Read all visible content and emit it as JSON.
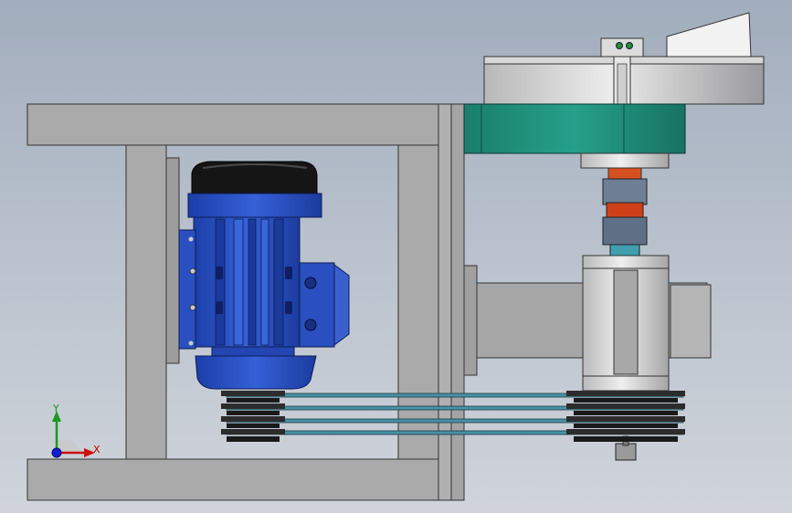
{
  "viewport": {
    "title": "",
    "background_top": "#a2adbd",
    "background_bottom": "#d0d4da"
  },
  "model": {
    "components": [
      "steel-frame",
      "electric-motor",
      "v-belt-pulleys",
      "jaw-coupling",
      "bearing-housing",
      "rotating-disc",
      "green-flange"
    ],
    "colors": {
      "frame": "#a9a9a9",
      "motor_blue": "#2a4fc0",
      "flange_green": "#1e8c78",
      "belt": "#3e8ea0",
      "coupling_orange": "#d6501e"
    }
  },
  "triad": {
    "x_label": "X",
    "y_label": "Y",
    "x_color": "#d01010",
    "y_color": "#1a9a1a",
    "z_color": "#1020d0"
  }
}
